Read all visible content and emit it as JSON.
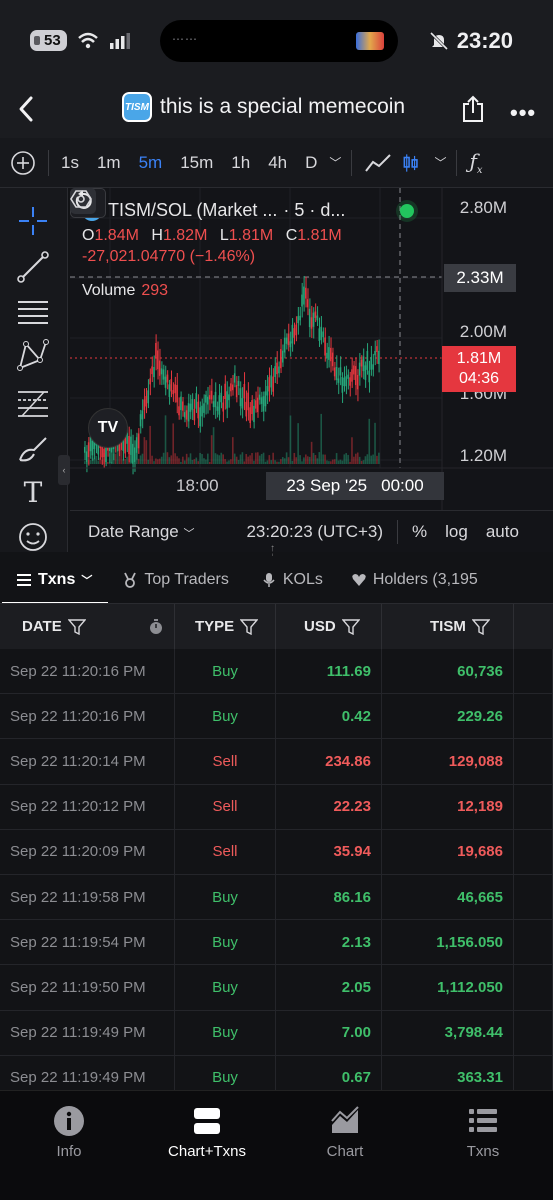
{
  "status_bar": {
    "battery": "53",
    "time": "23:20"
  },
  "header": {
    "title": "this is a special memecoin",
    "token_logo_text": "TISM"
  },
  "toolbar": {
    "timeframes": [
      "1s",
      "1m",
      "5m",
      "15m",
      "1h",
      "4h",
      "D"
    ],
    "active_timeframe": "5m"
  },
  "chart": {
    "pair": "TISM/SOL (Market ...",
    "interval": "· 5 · d...",
    "ohlc": {
      "o_label": "O",
      "o": "1.84M",
      "h_label": "H",
      "h": "1.82M",
      "l_label": "L",
      "l": "1.81M",
      "c_label": "C",
      "c": "1.81M"
    },
    "change": "-27,021.04770 (−1.46%)",
    "volume_label": "Volume",
    "volume_value": "293",
    "y_labels": [
      "2.80M",
      "2.00M",
      "1.60M",
      "1.20M"
    ],
    "crosshair_price": "2.33M",
    "current_price": "1.81M",
    "countdown": "04:36",
    "x_label_1": "18:00",
    "x_date": "23 Sep '25",
    "x_time": "00:00",
    "bottom": {
      "date_range": "Date Range",
      "timezone": "23:20:23 (UTC+3)",
      "percent": "%",
      "log": "log",
      "auto": "auto"
    },
    "badge": "TV"
  },
  "tabs": [
    {
      "label": "Txns"
    },
    {
      "label": "Top Traders"
    },
    {
      "label": "KOLs"
    },
    {
      "label": "Holders (3,195"
    }
  ],
  "table": {
    "headers": {
      "date": "DATE",
      "type": "TYPE",
      "usd": "USD",
      "tism": "TISM"
    },
    "rows": [
      {
        "date": "Sep 22 11:20:16 PM",
        "type": "Buy",
        "usd": "111.69",
        "tism": "60,736"
      },
      {
        "date": "Sep 22 11:20:16 PM",
        "type": "Buy",
        "usd": "0.42",
        "tism": "229.26"
      },
      {
        "date": "Sep 22 11:20:14 PM",
        "type": "Sell",
        "usd": "234.86",
        "tism": "129,088"
      },
      {
        "date": "Sep 22 11:20:12 PM",
        "type": "Sell",
        "usd": "22.23",
        "tism": "12,189"
      },
      {
        "date": "Sep 22 11:20:09 PM",
        "type": "Sell",
        "usd": "35.94",
        "tism": "19,686"
      },
      {
        "date": "Sep 22 11:19:58 PM",
        "type": "Buy",
        "usd": "86.16",
        "tism": "46,665"
      },
      {
        "date": "Sep 22 11:19:54 PM",
        "type": "Buy",
        "usd": "2.13",
        "tism": "1,156.050"
      },
      {
        "date": "Sep 22 11:19:50 PM",
        "type": "Buy",
        "usd": "2.05",
        "tism": "1,112.050"
      },
      {
        "date": "Sep 22 11:19:49 PM",
        "type": "Buy",
        "usd": "7.00",
        "tism": "3,798.44"
      },
      {
        "date": "Sep 22 11:19:49 PM",
        "type": "Buy",
        "usd": "0.67",
        "tism": "363.31"
      }
    ]
  },
  "bottom_nav": [
    {
      "label": "Info",
      "icon": "info-icon"
    },
    {
      "label": "Chart+Txns",
      "icon": "split-view-icon"
    },
    {
      "label": "Chart",
      "icon": "area-chart-icon"
    },
    {
      "label": "Txns",
      "icon": "list-icon"
    }
  ],
  "colors": {
    "buy": "#3fbf6a",
    "sell": "#ef5b5b",
    "accent": "#3b82f6",
    "price_box": "#e5373f"
  }
}
